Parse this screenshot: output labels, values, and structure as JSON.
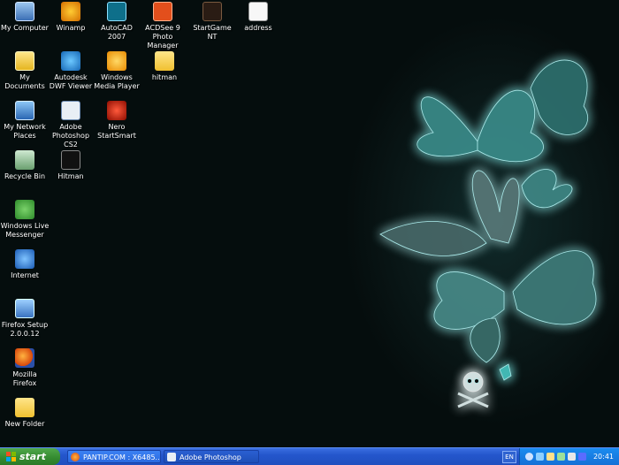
{
  "desktop": {
    "icons": [
      {
        "label": "My Computer",
        "icon": "my-computer-icon"
      },
      {
        "label": "Winamp",
        "icon": "winamp-icon"
      },
      {
        "label": "AutoCAD 2007",
        "icon": "autocad-icon"
      },
      {
        "label": "ACDSee 9 Photo Manager",
        "icon": "acdsee-icon"
      },
      {
        "label": "StartGame NT",
        "icon": "game-icon"
      },
      {
        "label": "address",
        "icon": "text-document-icon"
      },
      {
        "label": "My Documents",
        "icon": "my-documents-icon"
      },
      {
        "label": "Autodesk DWF Viewer",
        "icon": "dwf-viewer-icon"
      },
      {
        "label": "Windows Media Player",
        "icon": "media-player-icon"
      },
      {
        "label": "hitman",
        "icon": "folder-icon"
      },
      {
        "label": "My Network Places",
        "icon": "network-places-icon"
      },
      {
        "label": "Adobe Photoshop CS2",
        "icon": "photoshop-icon"
      },
      {
        "label": "Nero StartSmart",
        "icon": "nero-icon"
      },
      {
        "label": "Recycle Bin",
        "icon": "recycle-bin-icon"
      },
      {
        "label": "Hitman",
        "icon": "hitman-icon"
      },
      {
        "label": "Windows Live Messenger",
        "icon": "messenger-icon"
      },
      {
        "label": "Internet",
        "icon": "internet-explorer-icon"
      },
      {
        "label": "Firefox Setup 2.0.0.12",
        "icon": "installer-icon"
      },
      {
        "label": "Mozilla Firefox",
        "icon": "firefox-icon"
      },
      {
        "label": "New Folder",
        "icon": "folder-icon"
      }
    ]
  },
  "taskbar": {
    "start_label": "start",
    "buttons": [
      {
        "label": "PANTIP.COM : X6485...",
        "icon": "firefox-icon"
      },
      {
        "label": "Adobe Photoshop",
        "icon": "photoshop-icon"
      }
    ],
    "tray": {
      "language": "EN",
      "clock": "20:41"
    }
  },
  "colors": {
    "taskbar_blue": "#2456cc",
    "start_green": "#33892f",
    "wallpaper_glow": "#5ff0ee"
  }
}
